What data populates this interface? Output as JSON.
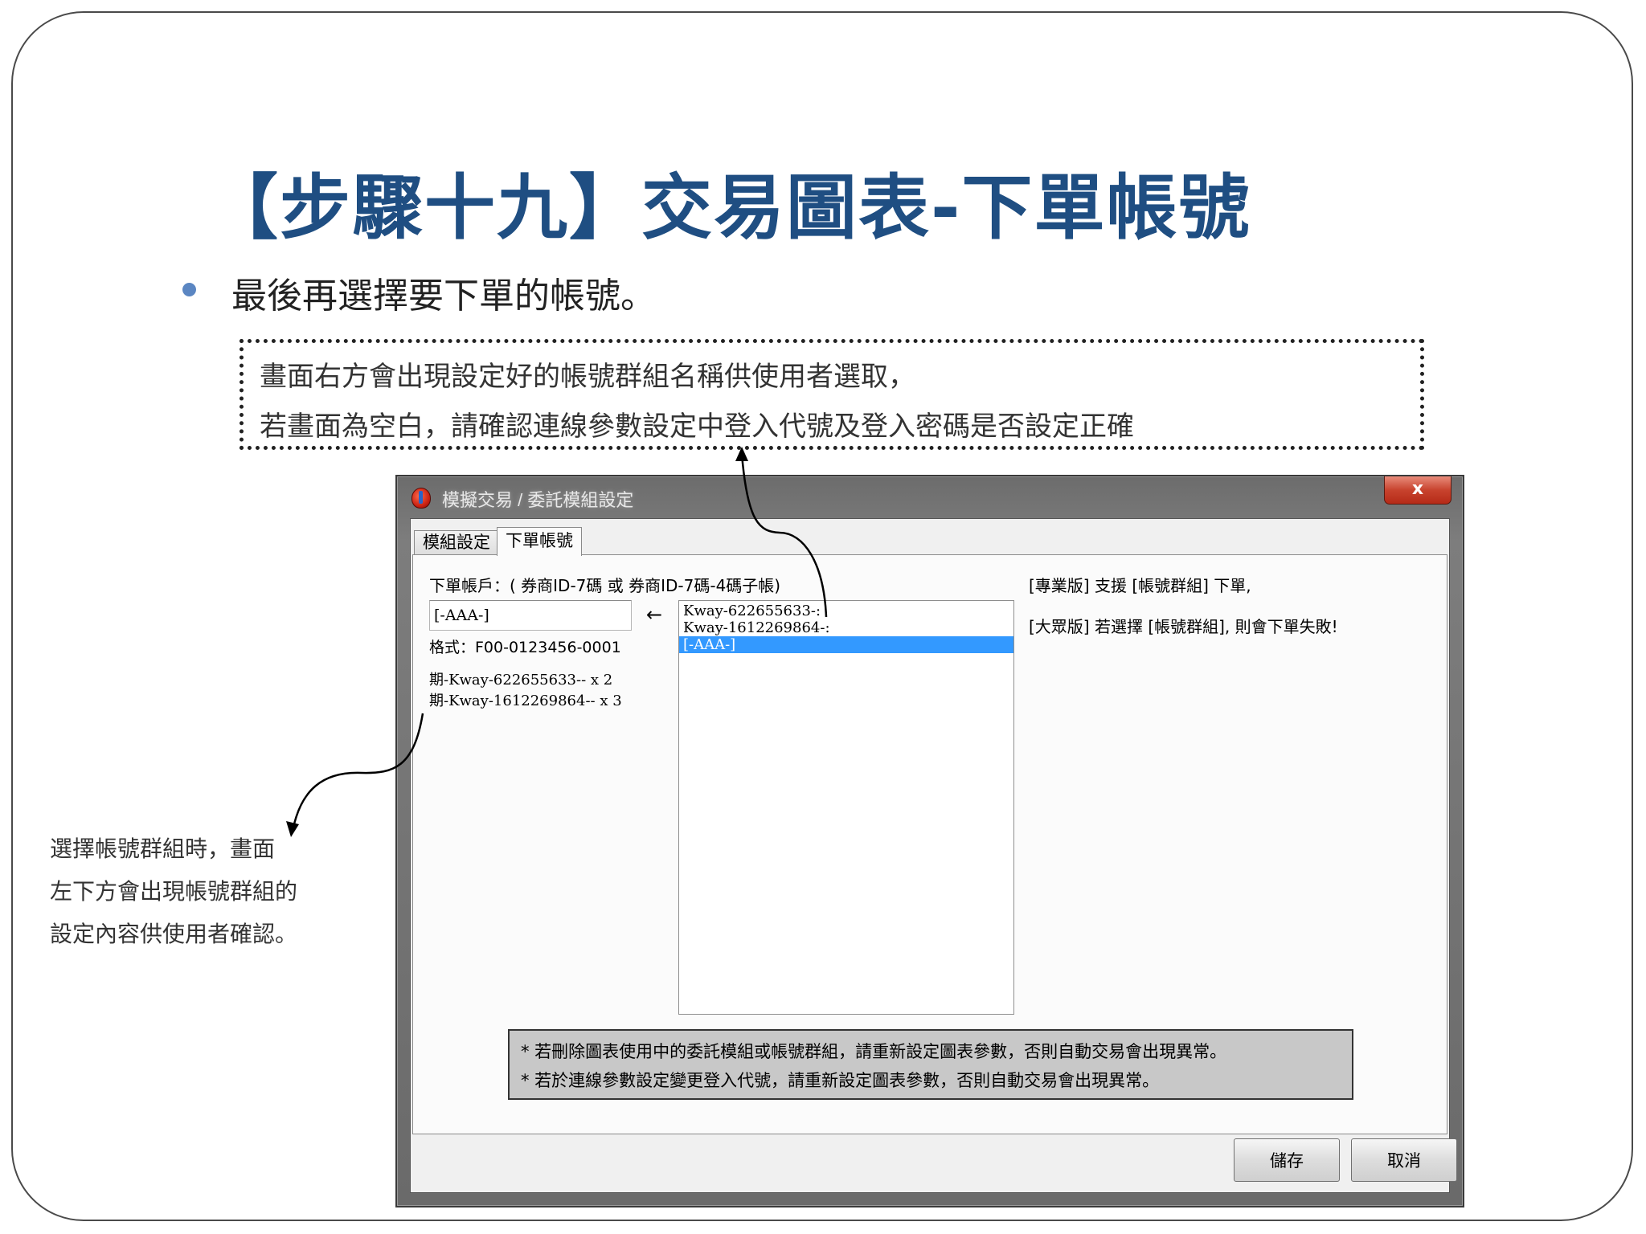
{
  "slide": {
    "title": "【步驟十九】交易圖表-下單帳號",
    "bullet": "最後再選擇要下單的帳號。",
    "note_lines": [
      "畫面右方會出現設定好的帳號群組名稱供使用者選取，",
      "若畫面為空白，請確認連線參數設定中登入代號及登入密碼是否設定正確"
    ],
    "side_note_lines": [
      "選擇帳號群組時，畫面",
      "左下方會出現帳號群組的",
      "設定內容供使用者確認。"
    ]
  },
  "dialog": {
    "title": "模擬交易 / 委託模組設定",
    "close_label": "x",
    "tabs": [
      {
        "label": "模組設定",
        "active": false
      },
      {
        "label": "下單帳號",
        "active": true
      }
    ],
    "account_label": "下單帳戶：( 券商ID-7碼 或 券商ID-7碼-4碼子帳)",
    "account_value": "[-AAA-]",
    "arrow_glyph": "←",
    "format_label": "格式：F00-0123456-0001",
    "group_details": [
      "期-Kway-622655633-- x 2",
      "期-Kway-1612269864-- x 3"
    ],
    "group_list": [
      {
        "label": "Kway-622655633-:",
        "selected": false
      },
      {
        "label": "Kway-1612269864-:",
        "selected": false
      },
      {
        "label": "[-AAA-]",
        "selected": true
      }
    ],
    "info_lines": [
      "[專業版] 支援 [帳號群組] 下單,",
      "[大眾版] 若選擇 [帳號群組], 則會下單失敗!"
    ],
    "warnings": [
      "* 若刪除圖表使用中的委託模組或帳號群組，請重新設定圖表參數，否則自動交易會出現異常。",
      "* 若於連線參數設定變更登入代號，請重新設定圖表參數，否則自動交易會出現異常。"
    ],
    "buttons": {
      "save": "儲存",
      "cancel": "取消"
    }
  },
  "colors": {
    "title": "#1f4e82",
    "bullet": "#5b86c2",
    "selection": "#3399ff"
  }
}
